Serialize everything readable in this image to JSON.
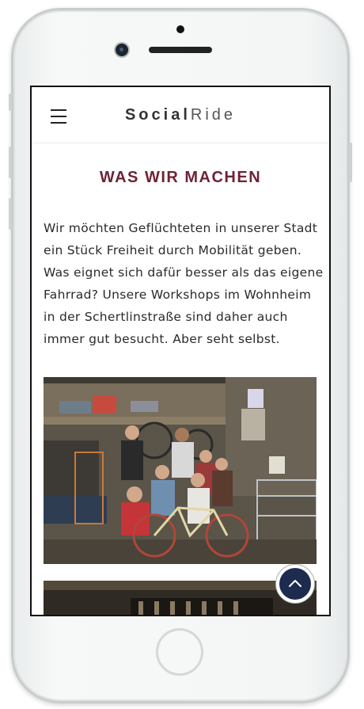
{
  "header": {
    "brand_part1": "Social",
    "brand_part2": "Ride"
  },
  "section": {
    "title": "WAS WIR MACHEN",
    "body_lines": [
      "Wir möchten Geflüchteten in unserer Stadt",
      "ein Stück Freiheit durch Mobilität geben.",
      "Was eignet sich dafür besser als das eigene",
      "Fahrrad? Unsere Workshops im Wohnheim",
      "in der Schertlinstraße sind daher auch",
      "immer gut besucht. Aber seht selbst."
    ]
  },
  "icons": {
    "menu": "hamburger-menu-icon",
    "scroll_top": "chevron-up-icon"
  },
  "colors": {
    "heading": "#6e2335",
    "scroll_button": "#1d2b4f"
  }
}
